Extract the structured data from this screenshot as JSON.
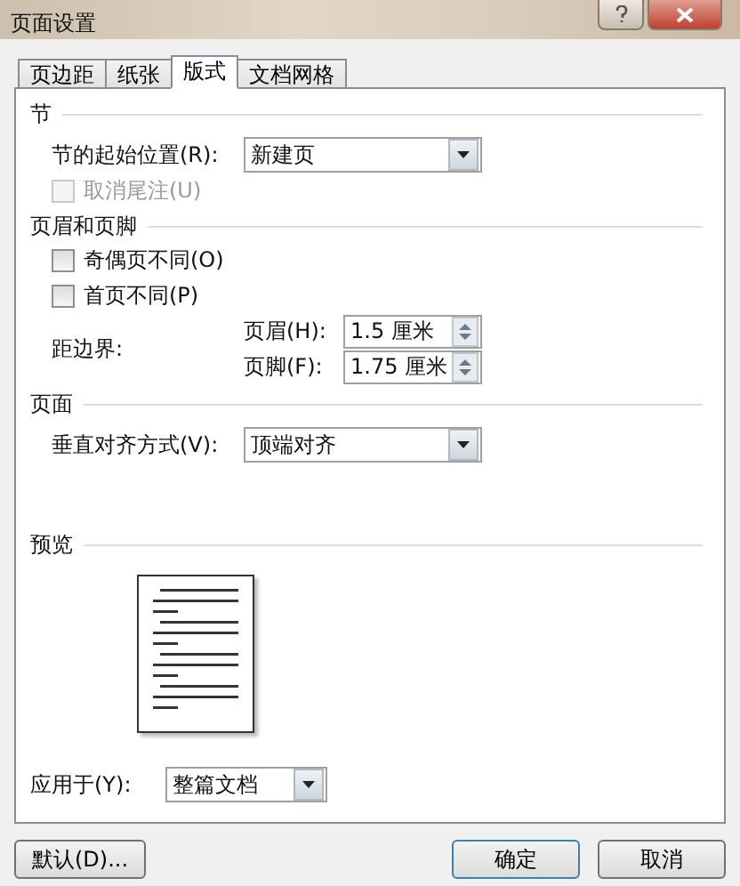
{
  "window": {
    "title": "页面设置"
  },
  "tabs": [
    {
      "label": "页边距",
      "selected": false
    },
    {
      "label": "纸张",
      "selected": false
    },
    {
      "label": "版式",
      "selected": true
    },
    {
      "label": "文档网格",
      "selected": false
    }
  ],
  "section": {
    "heading": "节",
    "start_label": "节的起始位置(R):",
    "start_value": "新建页",
    "endnote": {
      "label": "取消尾注(U)",
      "checked": false,
      "disabled": true
    }
  },
  "header_footer": {
    "heading": "页眉和页脚",
    "checkboxes": [
      {
        "label": "奇偶页不同(O)",
        "checked": false,
        "disabled": false
      },
      {
        "label": "首页不同(P)",
        "checked": false,
        "disabled": false
      }
    ],
    "distance_label": "距边界:",
    "spinners": [
      {
        "label": "页眉(H):",
        "value": "1.5 厘米"
      },
      {
        "label": "页脚(F):",
        "value": "1.75 厘米"
      }
    ]
  },
  "page": {
    "heading": "页面",
    "align_label": "垂直对齐方式(V):",
    "align_value": "顶端对齐"
  },
  "preview": {
    "heading": "预览",
    "apply_label": "应用于(Y):",
    "apply_value": "整篇文档"
  },
  "buttons": {
    "default": "默认(D)...",
    "ok": "确定",
    "cancel": "取消"
  }
}
